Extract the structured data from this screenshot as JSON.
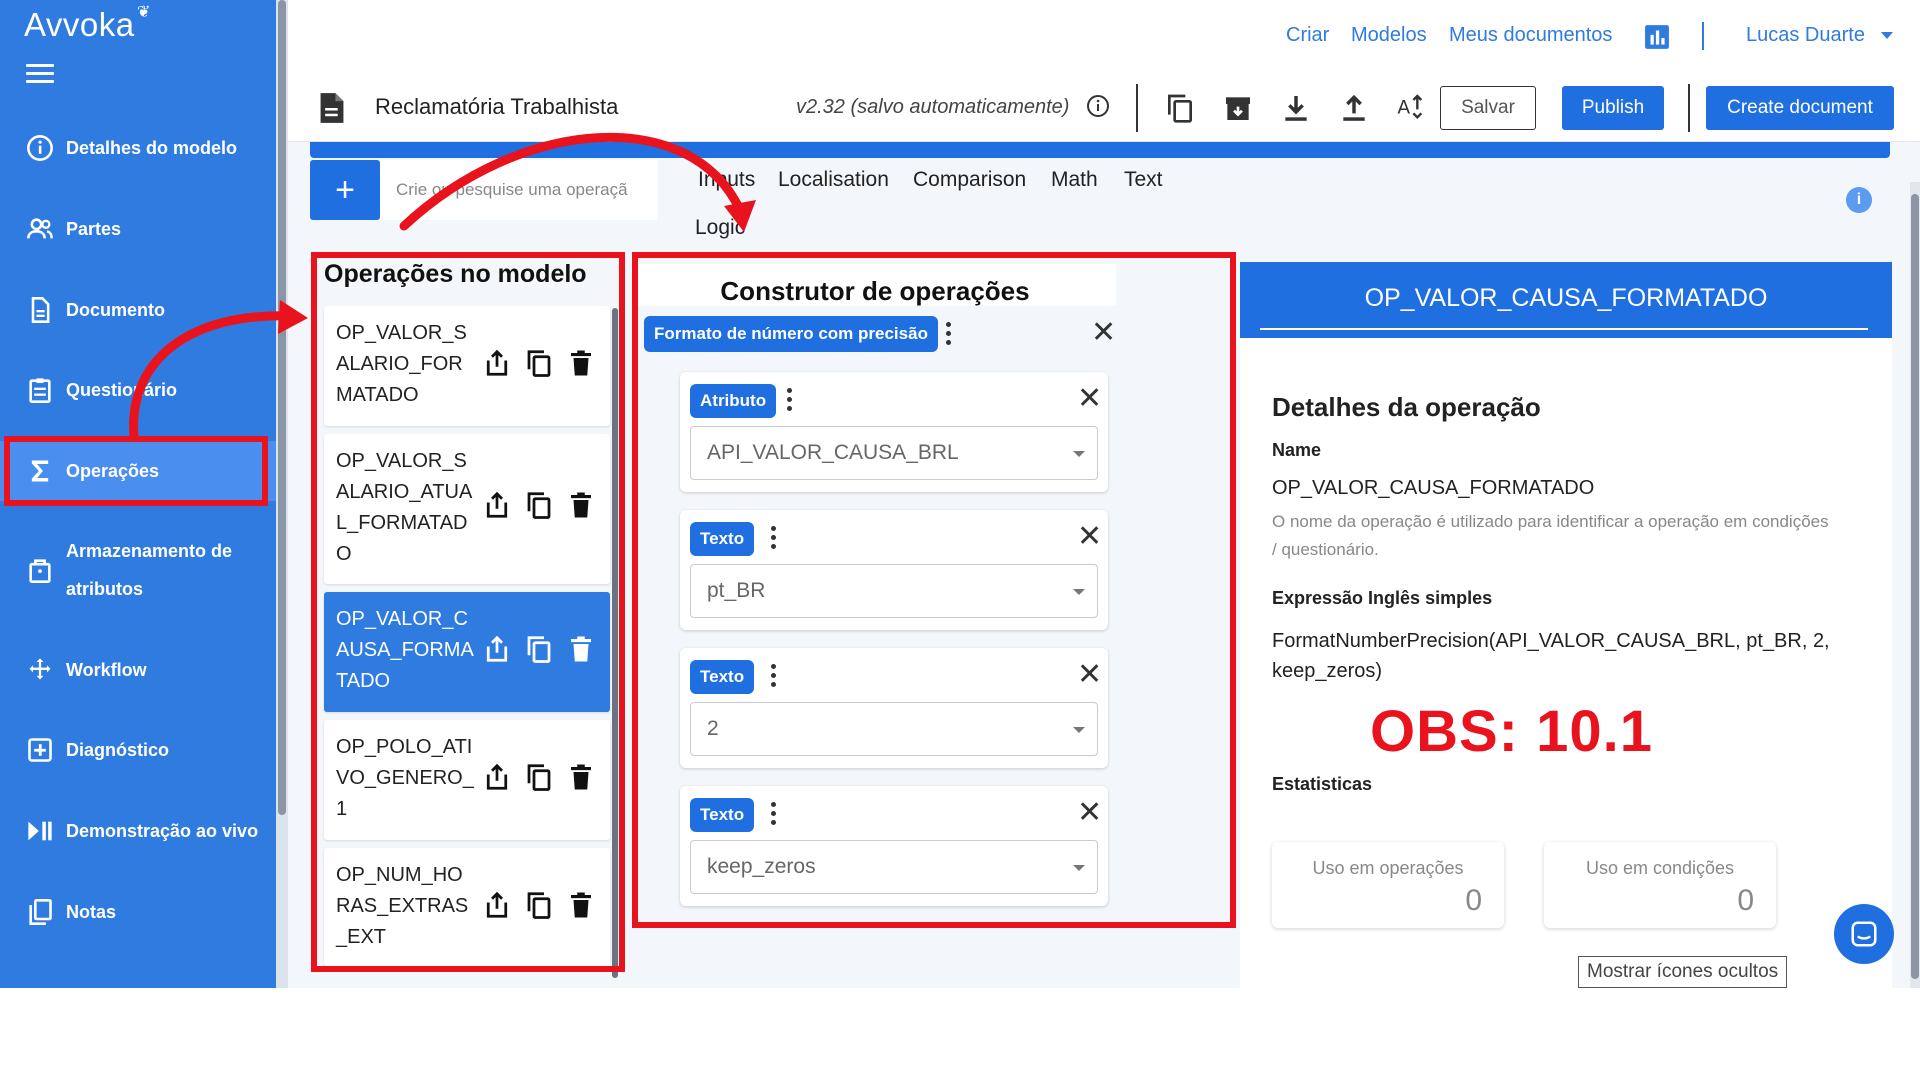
{
  "app": {
    "logo": "Avvoka",
    "accent": "#2f7be0",
    "button_blue": "#1f6fe0",
    "annotation_red": "#e8131c"
  },
  "sidebar": {
    "items": [
      {
        "label": "Detalhes do modelo",
        "icon": "info-icon"
      },
      {
        "label": "Partes",
        "icon": "people-icon"
      },
      {
        "label": "Documento",
        "icon": "document-icon"
      },
      {
        "label": "Questionário",
        "icon": "clipboard-icon"
      },
      {
        "label": "Operações",
        "icon": "sigma-icon",
        "active": true
      },
      {
        "label_line1": "Armazenamento de",
        "label_line2": "atributos",
        "icon": "bag-icon"
      },
      {
        "label": "Workflow",
        "icon": "workflow-icon"
      },
      {
        "label": "Diagnóstico",
        "icon": "plus-box-icon"
      },
      {
        "label": "Demonstração ao vivo",
        "icon": "play-pause-icon"
      },
      {
        "label": "Notas",
        "icon": "notes-icon"
      }
    ]
  },
  "topnav": {
    "links": [
      "Criar",
      "Modelos",
      "Meus documentos"
    ],
    "user": "Lucas Duarte"
  },
  "docbar": {
    "title": "Reclamatória Trabalhista",
    "version": "v2.32 (salvo automaticamente)",
    "save_label": "Salvar",
    "publish_label": "Publish",
    "create_label": "Create document"
  },
  "operations_bar": {
    "add_label": "+",
    "search_placeholder": "Crie ou pesquise uma operaçã",
    "categories": [
      "Inputs",
      "Localisation",
      "Comparison",
      "Math",
      "Text",
      "Logic"
    ]
  },
  "operations_list": {
    "title": "Operações no modelo",
    "items": [
      {
        "name": "OP_VALOR_SALARIO_FORMATADO"
      },
      {
        "name": "OP_VALOR_SALARIO_ATUAL_FORMATADO"
      },
      {
        "name": "OP_VALOR_CAUSA_FORMATADO",
        "selected": true
      },
      {
        "name": "OP_POLO_ATIVO_GENERO_1"
      },
      {
        "name": "OP_NUM_HORAS_EXTRAS_EXT"
      }
    ]
  },
  "builder": {
    "title": "Construtor de operações",
    "function_label": "Formato de número com precisão",
    "args": [
      {
        "type": "Atributo",
        "value": "API_VALOR_CAUSA_BRL"
      },
      {
        "type": "Texto",
        "value": "pt_BR"
      },
      {
        "type": "Texto",
        "value": "2"
      },
      {
        "type": "Texto",
        "value": "keep_zeros"
      }
    ]
  },
  "details": {
    "header": "OP_VALOR_CAUSA_FORMATADO",
    "section_title": "Detalhes da operação",
    "name_label": "Name",
    "name_value": "OP_VALOR_CAUSA_FORMATADO",
    "name_hint": "O nome da operação é utilizado para identificar a operação em condições / questionário.",
    "expr_label": "Expressão Inglês simples",
    "expr_value": "FormatNumberPrecision(API_VALOR_CAUSA_BRL, pt_BR, 2, keep_zeros)",
    "stats_label": "Estatisticas",
    "stats": [
      {
        "label": "Uso em operações",
        "value": "0"
      },
      {
        "label": "Uso em condições",
        "value": "0"
      }
    ],
    "show_hidden_label": "Mostrar ícones ocultos"
  },
  "annotation": {
    "note": "OBS: 10.1"
  }
}
